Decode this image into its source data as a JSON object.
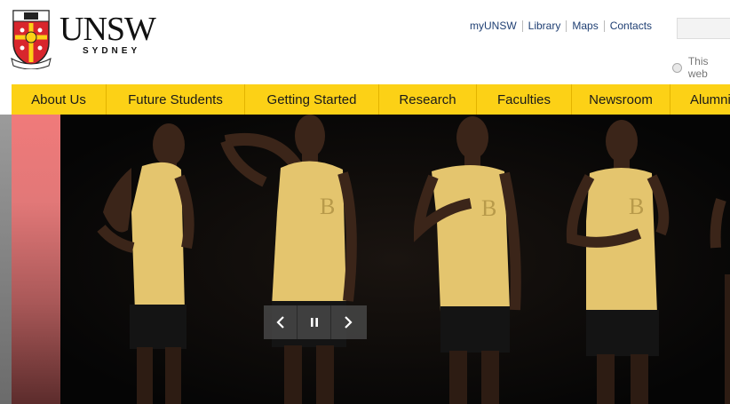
{
  "brand": {
    "name": "UNSW",
    "sub": "SYDNEY",
    "crest_motto": "MANU ET MENTE"
  },
  "top_links": [
    "myUNSW",
    "Library",
    "Maps",
    "Contacts"
  ],
  "search": {
    "scope_label": "This web"
  },
  "nav": {
    "items": [
      "About Us",
      "Future Students",
      "Getting Started",
      "Research",
      "Faculties",
      "Newsroom",
      "Alumni"
    ]
  },
  "slider": {
    "prev_icon": "chevron-left-icon",
    "pause_icon": "pause-icon",
    "next_icon": "chevron-right-icon"
  },
  "colors": {
    "nav_bg": "#fcd116",
    "link": "#1f3f73"
  }
}
